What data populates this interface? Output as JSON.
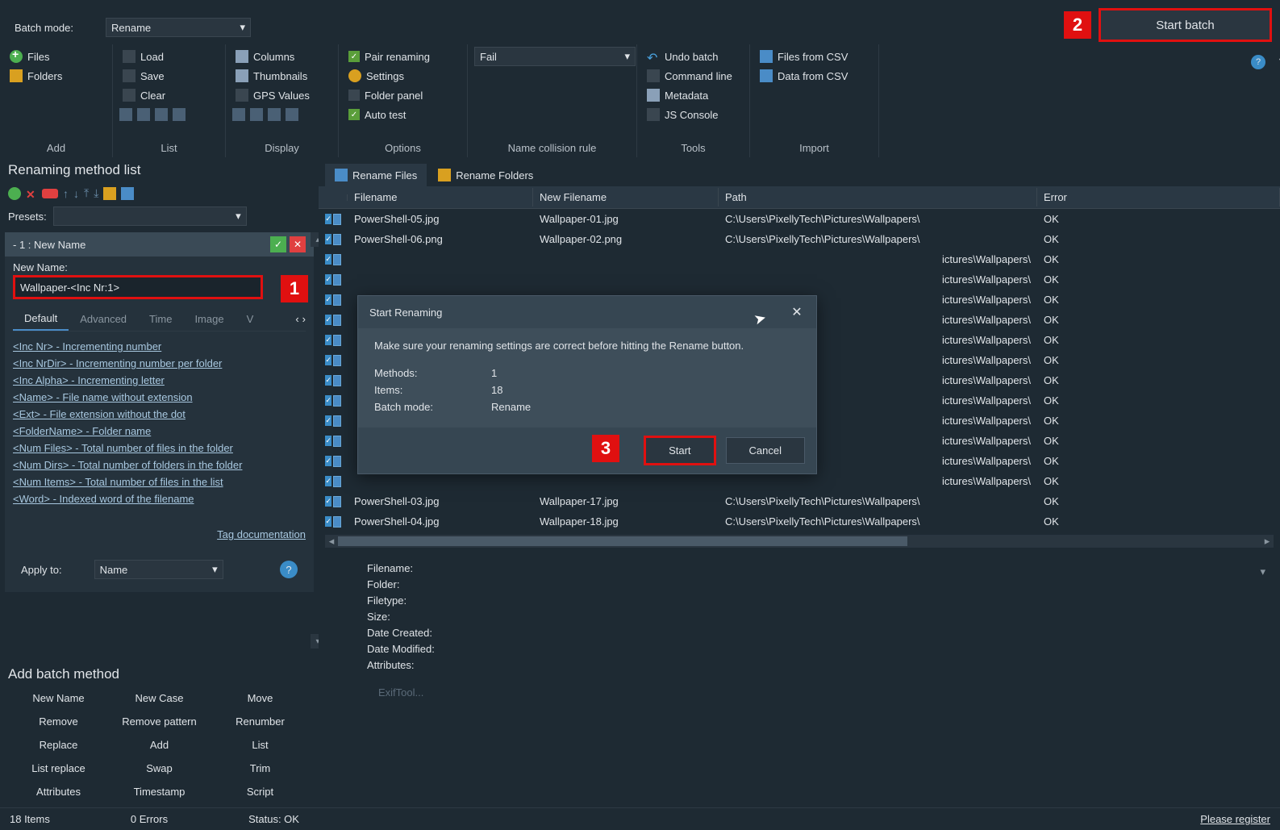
{
  "batch_mode_label": "Batch mode:",
  "batch_mode_value": "Rename",
  "start_batch_label": "Start batch",
  "ribbon": {
    "add": {
      "files": "Files",
      "folders": "Folders",
      "label": "Add"
    },
    "list": {
      "load": "Load",
      "save": "Save",
      "clear": "Clear",
      "label": "List"
    },
    "display": {
      "columns": "Columns",
      "thumbnails": "Thumbnails",
      "gps": "GPS Values",
      "label": "Display"
    },
    "options": {
      "pair": "Pair renaming",
      "settings": "Settings",
      "folder_panel": "Folder panel",
      "auto_test": "Auto test",
      "label": "Options"
    },
    "collision": {
      "value": "Fail",
      "label": "Name collision rule"
    },
    "tools": {
      "undo": "Undo batch",
      "cmd": "Command line",
      "meta": "Metadata",
      "js": "JS Console",
      "label": "Tools"
    },
    "import": {
      "files_csv": "Files from CSV",
      "data_csv": "Data from CSV",
      "label": "Import"
    }
  },
  "rml": {
    "header": "Renaming method list",
    "presets": "Presets:",
    "method_title": "- 1 : New Name",
    "new_name_label": "New Name:",
    "new_name_value": "Wallpaper-<Inc Nr:1>",
    "tabs": [
      "Default",
      "Advanced",
      "Time",
      "Image",
      "V"
    ],
    "active_tab": 0,
    "tags": [
      "<Inc Nr> - Incrementing number",
      "<Inc NrDir> - Incrementing number per folder",
      "<Inc Alpha> - Incrementing letter",
      "<Name> - File name without extension",
      "<Ext> - File extension without the dot",
      "<FolderName> - Folder name",
      "<Num Files> - Total number of files in the folder",
      "<Num Dirs> - Total number of folders in the folder",
      "<Num Items> - Total number of files in the list",
      "<Word> - Indexed word of the filename"
    ],
    "tag_doc": "Tag documentation",
    "apply_to_label": "Apply to:",
    "apply_to_value": "Name"
  },
  "abm": {
    "header": "Add batch method",
    "items": [
      "New Name",
      "New Case",
      "Move",
      "Remove",
      "Remove pattern",
      "Renumber",
      "Replace",
      "Add",
      "List",
      "List replace",
      "Swap",
      "Trim",
      "Attributes",
      "Timestamp",
      "Script"
    ]
  },
  "file_tabs": {
    "files": "Rename Files",
    "folders": "Rename Folders"
  },
  "table": {
    "cols": {
      "fn": "Filename",
      "nfn": "New Filename",
      "path": "Path",
      "err": "Error"
    },
    "rows": [
      {
        "fn": "PowerShell-05.jpg",
        "nfn": "Wallpaper-01.jpg",
        "path": "C:\\Users\\PixellyTech\\Pictures\\Wallpapers\\",
        "err": "OK"
      },
      {
        "fn": "PowerShell-06.png",
        "nfn": "Wallpaper-02.png",
        "path": "C:\\Users\\PixellyTech\\Pictures\\Wallpapers\\",
        "err": "OK"
      },
      {
        "fn": "",
        "nfn": "",
        "path": "ictures\\Wallpapers\\",
        "err": "OK"
      },
      {
        "fn": "",
        "nfn": "",
        "path": "ictures\\Wallpapers\\",
        "err": "OK"
      },
      {
        "fn": "",
        "nfn": "",
        "path": "ictures\\Wallpapers\\",
        "err": "OK"
      },
      {
        "fn": "",
        "nfn": "",
        "path": "ictures\\Wallpapers\\",
        "err": "OK"
      },
      {
        "fn": "",
        "nfn": "",
        "path": "ictures\\Wallpapers\\",
        "err": "OK"
      },
      {
        "fn": "",
        "nfn": "",
        "path": "ictures\\Wallpapers\\",
        "err": "OK"
      },
      {
        "fn": "",
        "nfn": "",
        "path": "ictures\\Wallpapers\\",
        "err": "OK"
      },
      {
        "fn": "",
        "nfn": "",
        "path": "ictures\\Wallpapers\\",
        "err": "OK"
      },
      {
        "fn": "",
        "nfn": "",
        "path": "ictures\\Wallpapers\\",
        "err": "OK"
      },
      {
        "fn": "",
        "nfn": "",
        "path": "ictures\\Wallpapers\\",
        "err": "OK"
      },
      {
        "fn": "",
        "nfn": "",
        "path": "ictures\\Wallpapers\\",
        "err": "OK"
      },
      {
        "fn": "",
        "nfn": "",
        "path": "ictures\\Wallpapers\\",
        "err": "OK"
      },
      {
        "fn": "PowerShell-03.jpg",
        "nfn": "Wallpaper-17.jpg",
        "path": "C:\\Users\\PixellyTech\\Pictures\\Wallpapers\\",
        "err": "OK"
      },
      {
        "fn": "PowerShell-04.jpg",
        "nfn": "Wallpaper-18.jpg",
        "path": "C:\\Users\\PixellyTech\\Pictures\\Wallpapers\\",
        "err": "OK"
      }
    ]
  },
  "dialog": {
    "title": "Start Renaming",
    "msg": "Make sure your renaming settings are correct before hitting the Rename button.",
    "methods_label": "Methods:",
    "methods_val": "1",
    "items_label": "Items:",
    "items_val": "18",
    "mode_label": "Batch mode:",
    "mode_val": "Rename",
    "start": "Start",
    "cancel": "Cancel"
  },
  "info": {
    "filename": "Filename:",
    "folder": "Folder:",
    "filetype": "Filetype:",
    "size": "Size:",
    "created": "Date Created:",
    "modified": "Date Modified:",
    "attributes": "Attributes:",
    "exif": "ExifTool..."
  },
  "status": {
    "items": "18 Items",
    "errors": "0 Errors",
    "status": "Status: OK",
    "register": "Please register"
  },
  "callouts": {
    "c1": "1",
    "c2": "2",
    "c3": "3"
  }
}
